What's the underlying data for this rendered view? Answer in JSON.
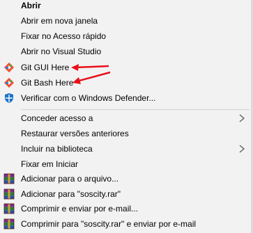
{
  "menu": {
    "group1": [
      {
        "label": "Abrir",
        "icon": null
      },
      {
        "label": "Abrir em nova janela",
        "icon": null
      },
      {
        "label": "Fixar no Acesso rápido",
        "icon": null
      },
      {
        "label": "Abrir no Visual Studio",
        "icon": null
      },
      {
        "label": "Git GUI Here",
        "icon": "git-icon"
      },
      {
        "label": "Git Bash Here",
        "icon": "git-icon"
      },
      {
        "label": "Verificar com o Windows Defender...",
        "icon": "windows-defender-icon"
      }
    ],
    "group2": [
      {
        "label": "Conceder acesso a",
        "submenu": true
      },
      {
        "label": "Restaurar versões anteriores"
      },
      {
        "label": "Incluir na biblioteca",
        "submenu": true
      },
      {
        "label": "Fixar em Iniciar"
      }
    ],
    "group3": [
      {
        "label": "Adicionar para o arquivo...",
        "icon": "winrar-icon"
      },
      {
        "label": "Adicionar para \"soscity.rar\"",
        "icon": "winrar-icon"
      },
      {
        "label": "Comprimir e enviar por e-mail...",
        "icon": "winrar-icon"
      },
      {
        "label": "Comprimir para \"soscity.rar\" e enviar por e-mail",
        "icon": "winrar-icon"
      }
    ]
  },
  "colors": {
    "menu_background": "#f2f2f2",
    "annotation_arrow": "#e8101c",
    "git_diamond": "#f05033"
  }
}
